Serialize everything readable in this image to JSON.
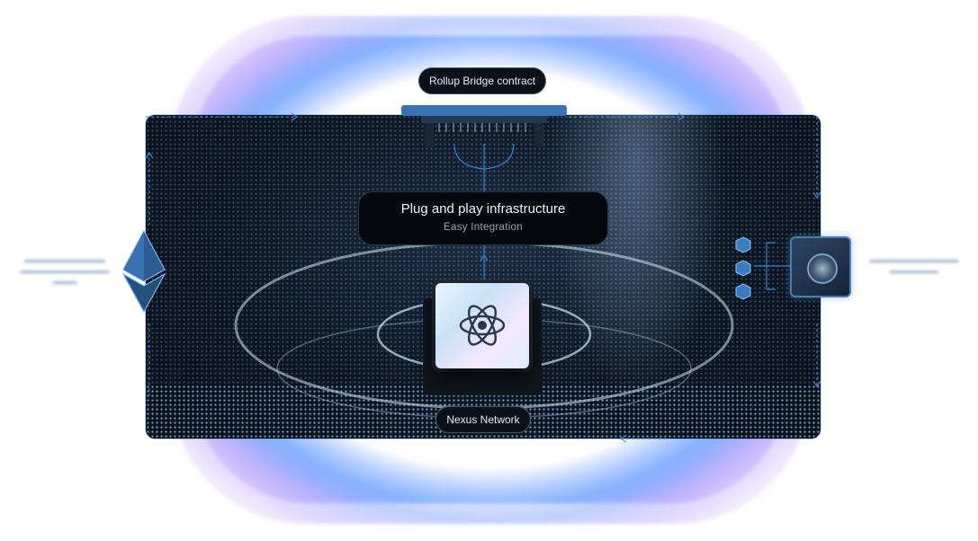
{
  "labels": {
    "bridge_contract": "Rollup Bridge contract",
    "headline": "Plug and play infrastructure",
    "subheadline": "Easy Integration",
    "network": "Nexus Network"
  },
  "colors": {
    "panel_bg": "#0c1622",
    "accent_blue": "#3a8ee0",
    "glow_purple": "#b49bff",
    "pill_bg": "#0b1119"
  },
  "icons": {
    "left": "ethereum-icon",
    "right_cubes": "block-cubes-icon",
    "right_vault": "vault-icon",
    "center": "nexus-chip-icon"
  }
}
